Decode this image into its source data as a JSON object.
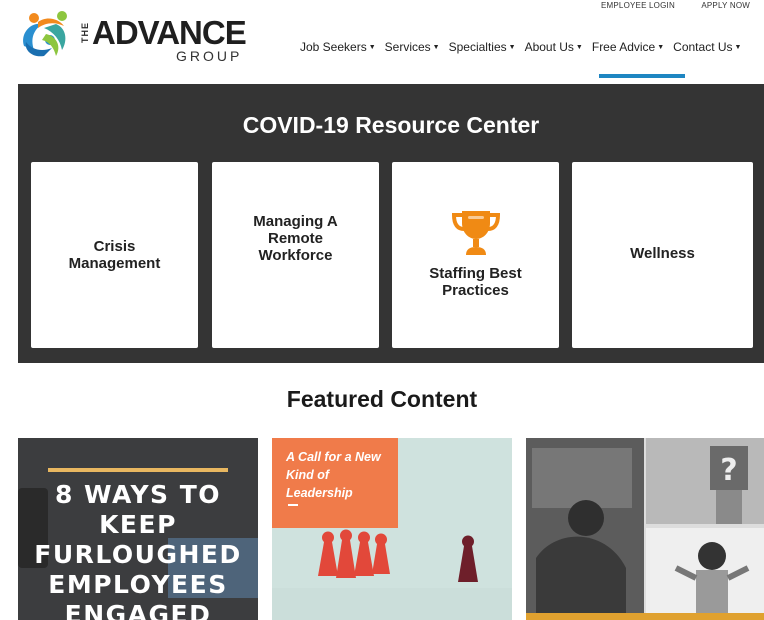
{
  "utility": {
    "employee_login": "EMPLOYEE LOGIN",
    "apply_now": "APPLY NOW"
  },
  "logo": {
    "the": "THE",
    "advance": "ADVANCE",
    "group": "GROUP"
  },
  "nav": {
    "items": [
      {
        "label": "Job Seekers"
      },
      {
        "label": "Services"
      },
      {
        "label": "Specialties"
      },
      {
        "label": "About Us"
      },
      {
        "label": "Free Advice"
      },
      {
        "label": "Contact Us"
      }
    ],
    "active": "Free Advice",
    "accent_color": "#1e86c2"
  },
  "covid": {
    "title": "COVID-19 Resource Center",
    "cards": [
      {
        "label": "Crisis Management"
      },
      {
        "label": "Managing A Remote Workforce"
      },
      {
        "label": "Staffing Best Practices",
        "icon": "trophy-icon"
      },
      {
        "label": "Wellness"
      }
    ],
    "background": "#343434"
  },
  "featured": {
    "title": "Featured Content",
    "items": [
      {
        "headline": "8 WAYS TO KEEP FURLOUGHED EMPLOYEES ENGAGED"
      },
      {
        "headline": "A Call for a New Kind of Leadership"
      },
      {
        "headline": ""
      }
    ]
  }
}
